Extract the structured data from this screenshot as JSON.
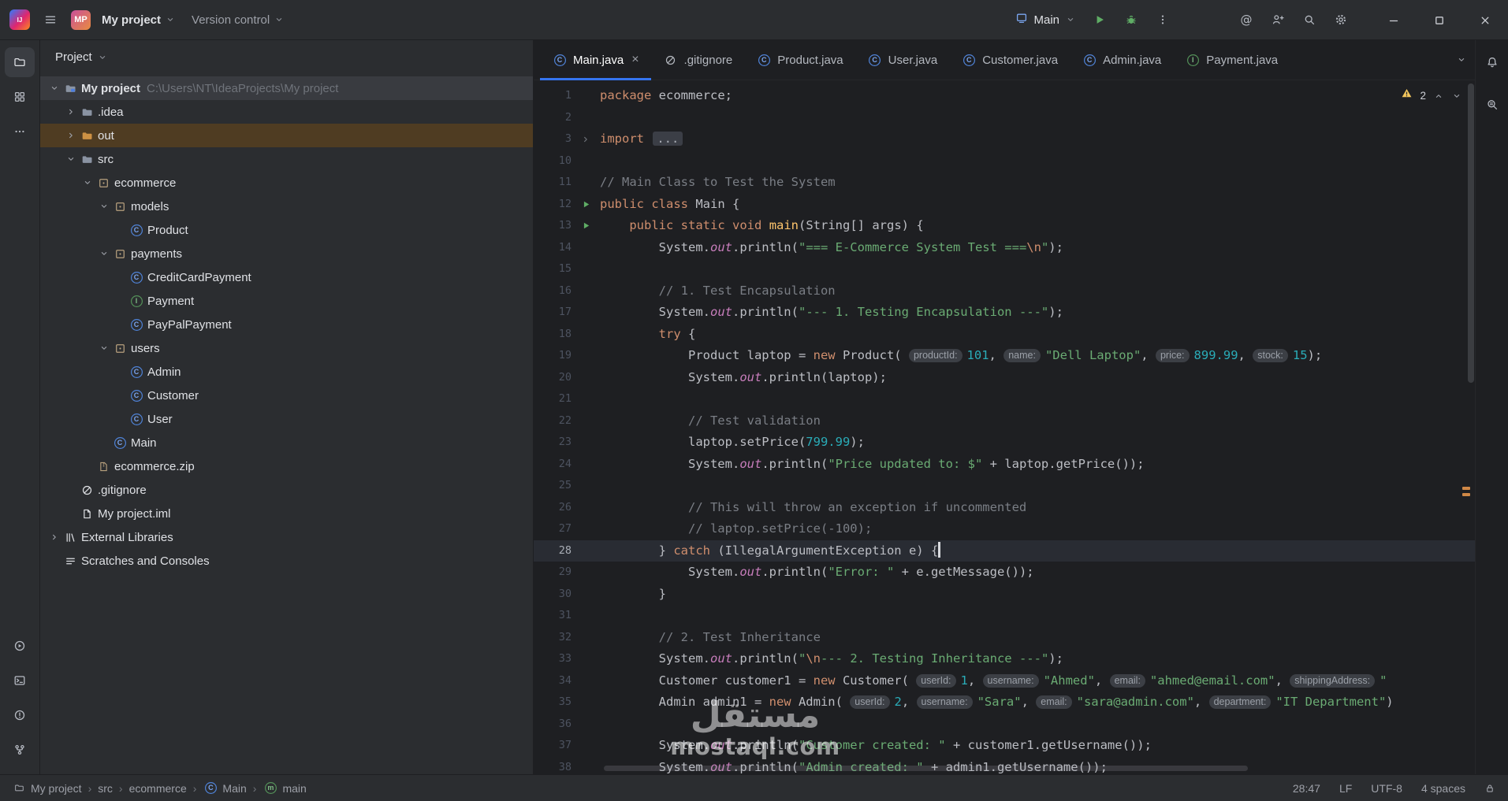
{
  "colors": {
    "accent": "#3574f0",
    "run_green": "#5fad65",
    "warning": "#f2c55c",
    "selected_row": "#393b40",
    "excluded_row": "#4f3c22"
  },
  "titlebar": {
    "project_badge": "MP",
    "project_name": "My project",
    "vcs_label": "Version control",
    "run_config": "Main",
    "actions": [
      {
        "name": "run-button",
        "icon": "play"
      },
      {
        "name": "debug-button",
        "icon": "bug"
      },
      {
        "name": "more-actions-button",
        "icon": "more-vert"
      }
    ],
    "tools": [
      {
        "name": "ai-assistant-button",
        "icon": "at"
      },
      {
        "name": "code-with-me-button",
        "icon": "person-plus"
      },
      {
        "name": "search-everywhere-button",
        "icon": "search"
      },
      {
        "name": "settings-button",
        "icon": "gear"
      }
    ],
    "window_buttons": [
      {
        "name": "minimize-button",
        "icon": "min"
      },
      {
        "name": "maximize-button",
        "icon": "max"
      },
      {
        "name": "close-button",
        "icon": "close"
      }
    ]
  },
  "activity_bar": {
    "top": [
      {
        "name": "project-tool-button",
        "icon": "folder-tool",
        "active": true
      },
      {
        "name": "commit-tool-button",
        "icon": "structure"
      },
      {
        "name": "more-tools-button",
        "icon": "more-horiz"
      }
    ],
    "bottom": [
      {
        "name": "run-tool-button",
        "icon": "run-circle"
      },
      {
        "name": "terminal-tool-button",
        "icon": "terminal"
      },
      {
        "name": "problems-tool-button",
        "icon": "problems"
      },
      {
        "name": "version-control-tool-button",
        "icon": "git"
      }
    ]
  },
  "right_strip": [
    {
      "name": "notifications-button",
      "icon": "bell"
    },
    {
      "name": "find-tool-button",
      "icon": "find"
    }
  ],
  "project": {
    "header": "Project",
    "items": [
      {
        "label": "My project",
        "hint": "C:\\Users\\NT\\IdeaProjects\\My project",
        "depth": 0,
        "icon": "project-root",
        "chevron": "open",
        "state": "selected",
        "root": true
      },
      {
        "label": ".idea",
        "depth": 1,
        "icon": "folder",
        "chevron": "closed"
      },
      {
        "label": "out",
        "depth": 1,
        "icon": "folder-out",
        "chevron": "closed",
        "state": "highlighted"
      },
      {
        "label": "src",
        "depth": 1,
        "icon": "folder",
        "chevron": "open"
      },
      {
        "label": "ecommerce",
        "depth": 2,
        "icon": "package",
        "chevron": "open"
      },
      {
        "label": "models",
        "depth": 3,
        "icon": "package",
        "chevron": "open"
      },
      {
        "label": "Product",
        "depth": 4,
        "icon": "class"
      },
      {
        "label": "payments",
        "depth": 3,
        "icon": "package",
        "chevron": "open"
      },
      {
        "label": "CreditCardPayment",
        "depth": 4,
        "icon": "class"
      },
      {
        "label": "Payment",
        "depth": 4,
        "icon": "interface"
      },
      {
        "label": "PayPalPayment",
        "depth": 4,
        "icon": "class"
      },
      {
        "label": "users",
        "depth": 3,
        "icon": "package",
        "chevron": "open"
      },
      {
        "label": "Admin",
        "depth": 4,
        "icon": "class"
      },
      {
        "label": "Customer",
        "depth": 4,
        "icon": "class"
      },
      {
        "label": "User",
        "depth": 4,
        "icon": "class"
      },
      {
        "label": "Main",
        "depth": 3,
        "icon": "class"
      },
      {
        "label": "ecommerce.zip",
        "depth": 2,
        "icon": "archive"
      },
      {
        "label": ".gitignore",
        "depth": 1,
        "icon": "ignore"
      },
      {
        "label": "My project.iml",
        "depth": 1,
        "icon": "file"
      },
      {
        "label": "External Libraries",
        "depth": 0,
        "icon": "libraries",
        "chevron": "closed"
      },
      {
        "label": "Scratches and Consoles",
        "depth": 0,
        "icon": "scratches"
      }
    ]
  },
  "tabs": [
    {
      "label": "Main.java",
      "icon": "class",
      "active": true,
      "closable": true
    },
    {
      "label": ".gitignore",
      "icon": "ignore"
    },
    {
      "label": "Product.java",
      "icon": "class"
    },
    {
      "label": "User.java",
      "icon": "class"
    },
    {
      "label": "Customer.java",
      "icon": "class"
    },
    {
      "label": "Admin.java",
      "icon": "class"
    },
    {
      "label": "Payment.java",
      "icon": "interface"
    }
  ],
  "editor": {
    "warning_count": "2",
    "lines": [
      {
        "num": "1",
        "seg": [
          [
            "k",
            "package"
          ],
          [
            "p",
            " ecommerce;"
          ]
        ]
      },
      {
        "num": "2",
        "seg": []
      },
      {
        "num": "3",
        "gutter": "fold",
        "seg": [
          [
            "k",
            "import"
          ],
          [
            "p",
            " "
          ],
          [
            "d",
            "..."
          ]
        ]
      },
      {
        "num": "10",
        "seg": []
      },
      {
        "num": "11",
        "seg": [
          [
            "c",
            "// Main Class to Test the System"
          ]
        ]
      },
      {
        "num": "12",
        "gutter": "run",
        "seg": [
          [
            "k",
            "public"
          ],
          [
            "p",
            " "
          ],
          [
            "k",
            "class"
          ],
          [
            "p",
            " Main {"
          ]
        ]
      },
      {
        "num": "13",
        "gutter": "run",
        "seg": [
          [
            "p",
            "    "
          ],
          [
            "k",
            "public"
          ],
          [
            "p",
            " "
          ],
          [
            "k",
            "static"
          ],
          [
            "p",
            " "
          ],
          [
            "k",
            "void"
          ],
          [
            "p",
            " "
          ],
          [
            "m",
            "main"
          ],
          [
            "p",
            "(String[] args) {"
          ]
        ]
      },
      {
        "num": "14",
        "seg": [
          [
            "p",
            "        System."
          ],
          [
            "f",
            "out"
          ],
          [
            "p",
            ".println("
          ],
          [
            "s",
            "\"=== E-Commerce System Test ==="
          ],
          [
            "e",
            "\\n"
          ],
          [
            "s",
            "\""
          ],
          [
            "p",
            ");"
          ]
        ]
      },
      {
        "num": "15",
        "seg": []
      },
      {
        "num": "16",
        "seg": [
          [
            "p",
            "        "
          ],
          [
            "c",
            "// 1. Test Encapsulation"
          ]
        ]
      },
      {
        "num": "17",
        "seg": [
          [
            "p",
            "        System."
          ],
          [
            "f",
            "out"
          ],
          [
            "p",
            ".println("
          ],
          [
            "s",
            "\"--- 1. Testing Encapsulation ---\""
          ],
          [
            "p",
            ");"
          ]
        ]
      },
      {
        "num": "18",
        "seg": [
          [
            "p",
            "        "
          ],
          [
            "k",
            "try"
          ],
          [
            "p",
            " {"
          ]
        ]
      },
      {
        "num": "19",
        "seg": [
          [
            "p",
            "            Product laptop = "
          ],
          [
            "k",
            "new"
          ],
          [
            "p",
            " Product( "
          ],
          [
            "h",
            "productId:"
          ],
          [
            "n",
            "101"
          ],
          [
            "p",
            ", "
          ],
          [
            "h",
            "name:"
          ],
          [
            "s",
            "\"Dell Laptop\""
          ],
          [
            "p",
            ", "
          ],
          [
            "h",
            "price:"
          ],
          [
            "n",
            "899.99"
          ],
          [
            "p",
            ", "
          ],
          [
            "h",
            "stock:"
          ],
          [
            "n",
            "15"
          ],
          [
            "p",
            ");"
          ]
        ]
      },
      {
        "num": "20",
        "seg": [
          [
            "p",
            "            System."
          ],
          [
            "f",
            "out"
          ],
          [
            "p",
            ".println(laptop);"
          ]
        ]
      },
      {
        "num": "21",
        "seg": []
      },
      {
        "num": "22",
        "seg": [
          [
            "p",
            "            "
          ],
          [
            "c",
            "// Test validation"
          ]
        ]
      },
      {
        "num": "23",
        "seg": [
          [
            "p",
            "            laptop.setPrice("
          ],
          [
            "n",
            "799.99"
          ],
          [
            "p",
            ");"
          ]
        ]
      },
      {
        "num": "24",
        "seg": [
          [
            "p",
            "            System."
          ],
          [
            "f",
            "out"
          ],
          [
            "p",
            ".println("
          ],
          [
            "s",
            "\"Price updated to: $\""
          ],
          [
            "p",
            " + laptop.getPrice());"
          ]
        ]
      },
      {
        "num": "25",
        "seg": []
      },
      {
        "num": "26",
        "seg": [
          [
            "p",
            "            "
          ],
          [
            "c",
            "// This will throw an exception if uncommented"
          ]
        ]
      },
      {
        "num": "27",
        "seg": [
          [
            "p",
            "            "
          ],
          [
            "c",
            "// laptop.setPrice(-100);"
          ]
        ]
      },
      {
        "num": "28",
        "current": true,
        "caret": true,
        "seg": [
          [
            "p",
            "        } "
          ],
          [
            "k",
            "catch"
          ],
          [
            "p",
            " (IllegalArgumentException e) {"
          ]
        ]
      },
      {
        "num": "29",
        "seg": [
          [
            "p",
            "            System."
          ],
          [
            "f",
            "out"
          ],
          [
            "p",
            ".println("
          ],
          [
            "s",
            "\"Error: \""
          ],
          [
            "p",
            " + e.getMessage());"
          ]
        ]
      },
      {
        "num": "30",
        "seg": [
          [
            "p",
            "        }"
          ]
        ]
      },
      {
        "num": "31",
        "seg": []
      },
      {
        "num": "32",
        "seg": [
          [
            "p",
            "        "
          ],
          [
            "c",
            "// 2. Test Inheritance"
          ]
        ]
      },
      {
        "num": "33",
        "seg": [
          [
            "p",
            "        System."
          ],
          [
            "f",
            "out"
          ],
          [
            "p",
            ".println("
          ],
          [
            "s",
            "\""
          ],
          [
            "e",
            "\\n"
          ],
          [
            "s",
            "--- 2. Testing Inheritance ---\""
          ],
          [
            "p",
            ");"
          ]
        ]
      },
      {
        "num": "34",
        "seg": [
          [
            "p",
            "        Customer customer1 = "
          ],
          [
            "k",
            "new"
          ],
          [
            "p",
            " Customer( "
          ],
          [
            "h",
            "userId:"
          ],
          [
            "n",
            "1"
          ],
          [
            "p",
            ", "
          ],
          [
            "h",
            "username:"
          ],
          [
            "s",
            "\"Ahmed\""
          ],
          [
            "p",
            ", "
          ],
          [
            "h",
            "email:"
          ],
          [
            "s",
            "\"ahmed@email.com\""
          ],
          [
            "p",
            ", "
          ],
          [
            "h",
            "shippingAddress:"
          ],
          [
            "s",
            "\""
          ]
        ]
      },
      {
        "num": "35",
        "seg": [
          [
            "p",
            "        Admin admin1 = "
          ],
          [
            "k",
            "new"
          ],
          [
            "p",
            " Admin( "
          ],
          [
            "h",
            "userId:"
          ],
          [
            "n",
            "2"
          ],
          [
            "p",
            ", "
          ],
          [
            "h",
            "username:"
          ],
          [
            "s",
            "\"Sara\""
          ],
          [
            "p",
            ", "
          ],
          [
            "h",
            "email:"
          ],
          [
            "s",
            "\"sara@admin.com\""
          ],
          [
            "p",
            ", "
          ],
          [
            "h",
            "department:"
          ],
          [
            "s",
            "\"IT Department\""
          ],
          [
            "p",
            ")"
          ]
        ]
      },
      {
        "num": "36",
        "seg": []
      },
      {
        "num": "37",
        "seg": [
          [
            "p",
            "        System."
          ],
          [
            "f",
            "out"
          ],
          [
            "p",
            ".println("
          ],
          [
            "s",
            "\"Customer created: \""
          ],
          [
            "p",
            " + customer1.getUsername());"
          ]
        ]
      },
      {
        "num": "38",
        "seg": [
          [
            "p",
            "        System."
          ],
          [
            "f",
            "out"
          ],
          [
            "p",
            ".println("
          ],
          [
            "s",
            "\"Admin created: \""
          ],
          [
            "p",
            " + admin1.getUsername());"
          ]
        ]
      }
    ]
  },
  "status_bar": {
    "breadcrumbs": [
      {
        "label": "My project",
        "icon": "folder-small"
      },
      {
        "label": "src"
      },
      {
        "label": "ecommerce"
      },
      {
        "label": "Main",
        "icon": "class"
      },
      {
        "label": "main",
        "icon": "method"
      }
    ],
    "right": [
      {
        "name": "cursor-position",
        "label": "28:47"
      },
      {
        "name": "line-separator",
        "label": "LF"
      },
      {
        "name": "file-encoding",
        "label": "UTF-8"
      },
      {
        "name": "indent-setting",
        "label": "4 spaces"
      },
      {
        "name": "readonly-lock",
        "icon": "lock"
      }
    ]
  },
  "watermark": {
    "line1": "مستقل",
    "line2": "mostaql.com"
  }
}
